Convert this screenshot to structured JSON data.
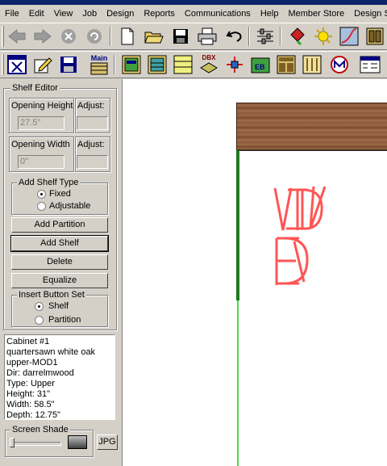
{
  "window": {
    "title_partial": ""
  },
  "menubar": [
    "File",
    "Edit",
    "View",
    "Job",
    "Design",
    "Reports",
    "Communications",
    "Help",
    "Member Store",
    "Design Sharing"
  ],
  "toolbar1": {
    "icons": [
      "back-arrow-icon",
      "forward-arrow-icon",
      "stop-icon",
      "refresh-icon",
      "new-document-icon",
      "open-folder-icon",
      "save-icon",
      "print-icon",
      "undo-icon",
      "settings-sliders-icon",
      "paint-bucket-icon",
      "light-icon",
      "chart-curve-icon",
      "cabinet-icon"
    ]
  },
  "toolbar2": {
    "main_label": "Main",
    "dbx_label": "DBX",
    "eb_label": "EB",
    "icons": [
      "close-window-icon",
      "edit-pencil-icon",
      "save-disk-icon",
      "main-cabinet-icon",
      "cabinet-a-icon",
      "cabinet-b-icon",
      "cabinet-c-icon",
      "dbx-icon",
      "tools-icon",
      "eb-icon",
      "drawer-cabinet-icon",
      "doors-icon",
      "cm-icon",
      "calculator-icon"
    ]
  },
  "shelf_editor": {
    "title": "Shelf Editor",
    "opening_height_label": "Opening Height",
    "opening_height_value": "27.5\"",
    "adjust_label": "Adjust:",
    "opening_width_label": "Opening Width",
    "opening_width_value": "0\"",
    "adjust_label2": "Adjust:",
    "add_shelf_type_label": "Add Shelf Type",
    "fixed_label": "Fixed",
    "adjustable_label": "Adjustable",
    "fixed_selected": true,
    "add_partition_label": "Add Partition",
    "add_shelf_label": "Add Shelf",
    "delete_label": "Delete",
    "equalize_label": "Equalize",
    "insert_button_set_label": "Insert Button Set",
    "shelf_label": "Shelf",
    "partition_label": "Partition",
    "shelf_selected": true
  },
  "cabinet_info": [
    "Cabinet #1",
    "quartersawn white oak",
    "upper-MOD1",
    "Dir: darrelmwood",
    "Type: Upper",
    "Height: 31\"",
    "Width: 58.5\"",
    "Depth: 12.75\""
  ],
  "screen_shade": {
    "label": "Screen Shade",
    "jpg_label": "JPG"
  },
  "colors": {
    "wall_dark": "#1f7a1f",
    "wall_light": "#44dd44",
    "marker_red": "#ff5555",
    "wood": "#8b5a3c"
  }
}
